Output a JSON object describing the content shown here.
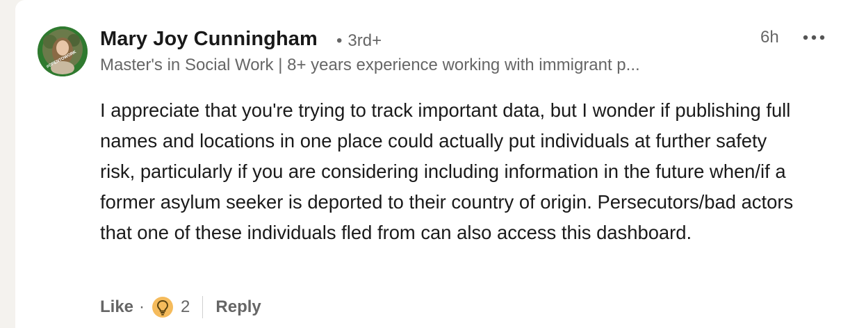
{
  "author": {
    "name": "Mary Joy Cunningham",
    "degree_separator": "•",
    "degree": "3rd+",
    "headline": "Master's in Social Work | 8+ years experience working with immigrant p...",
    "avatar_frame_text": "#OPENTOWORK"
  },
  "meta": {
    "time": "6h",
    "more_icon": "more-horizontal-icon"
  },
  "comment": {
    "text": "I appreciate that you're trying to track important data, but I wonder if publishing full names and locations in one place could actually put individuals at further safety risk, particularly if you are considering including information in the future when/if a former asylum seeker is deported to their country of origin. Persecutors/bad actors that one of these individuals fled from can also access this dashboard."
  },
  "actions": {
    "like_label": "Like",
    "separator": "·",
    "reaction_icon": "insightful-lightbulb-icon",
    "reaction_count": "2",
    "reply_label": "Reply"
  },
  "colors": {
    "background": "#f4f2ee",
    "card": "#ffffff",
    "text_primary": "#191919",
    "text_secondary": "#666666",
    "open_to_work_green": "#2f7a2f",
    "insight_yellow": "#f5bb5c"
  }
}
